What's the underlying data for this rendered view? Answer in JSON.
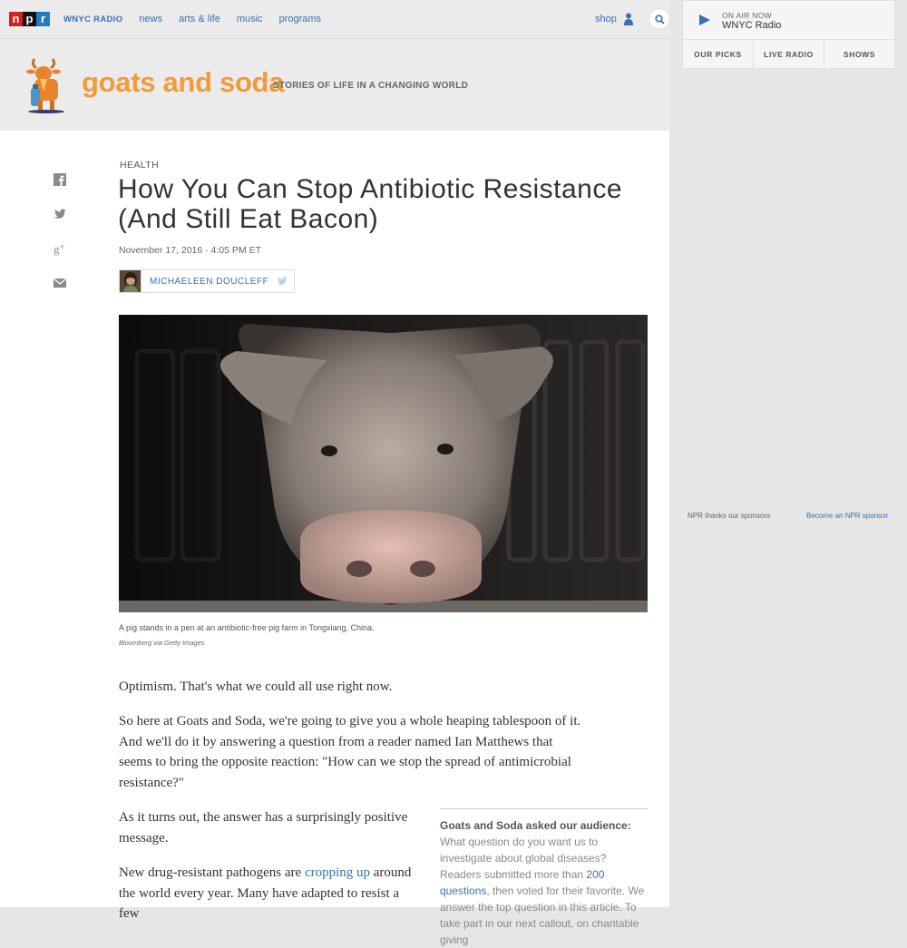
{
  "topnav": {
    "logo": [
      "n",
      "p",
      "r"
    ],
    "station": "WNYC RADIO",
    "links": [
      "news",
      "arts & life",
      "music",
      "programs"
    ],
    "shop": "shop"
  },
  "player": {
    "on_air": "ON AIR NOW",
    "station": "WNYC Radio",
    "tabs": [
      "OUR PICKS",
      "LIVE RADIO",
      "SHOWS"
    ]
  },
  "banner": {
    "brand": "goats and soda",
    "tagline": "STORIES OF LIFE IN A CHANGING WORLD"
  },
  "article": {
    "kicker": "HEALTH",
    "title": "How You Can Stop Antibiotic Resistance (And Still Eat Bacon)",
    "date": "November 17, 2016 · 4:05 PM ET",
    "author": "MICHAELEEN DOUCLEFF",
    "caption": "A pig stands in a pen at an antibiotic-free pig farm in Tongxiang, China.",
    "credit": "Bloomberg via Getty Images",
    "p1": "Optimism. That's what we could all use right now.",
    "p2": "So here at Goats and Soda, we're going to give you a whole heaping tablespoon of it. And we'll do it by answering a question from a reader named Ian Matthews that seems to bring the opposite reaction: \"How can we stop the spread of antimicrobial resistance?\"",
    "p3": "As it turns out, the answer has a surprisingly positive message.",
    "p4_start": "New drug-resistant pathogens are ",
    "p4_link": "cropping up",
    "p4_end": " around the world every year. Many have adapted to resist a few"
  },
  "note": {
    "lead": "Goats and Soda asked our audience:",
    "text1": " What question do you want us to investigate about global diseases? Readers submitted more than ",
    "link": "200 questions",
    "text2": ", then voted for their favorite. We answer the top question in this article. To take part in our next callout, on charitable giving"
  },
  "sponsor": {
    "thanks": "NPR thanks our sponsors",
    "become": "Become an NPR sponsor"
  },
  "colors": {
    "brand_orange": "#f29b38",
    "link_blue": "#3a6fb5",
    "npr_red": "#d62021",
    "npr_blue": "#237bbd"
  }
}
